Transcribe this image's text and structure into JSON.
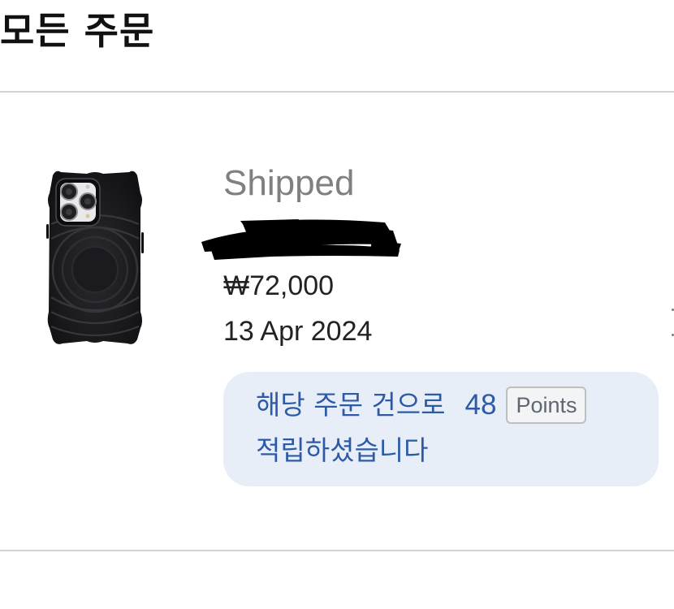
{
  "header": {
    "title": "모든 주문"
  },
  "order": {
    "status": "Shipped",
    "product_image_icon": "phone-case-image",
    "price": "₩72,000",
    "date": "13 Apr 2024",
    "points_banner": {
      "line1": "해당 주문 건으로",
      "points_value": "48",
      "points_unit": "Points",
      "line2": "적립하셨습니다"
    }
  },
  "colors": {
    "status_text": "#808080",
    "banner_background": "#e8eef8",
    "banner_text": "#2c5aa6",
    "divider": "#d4d4d4"
  }
}
